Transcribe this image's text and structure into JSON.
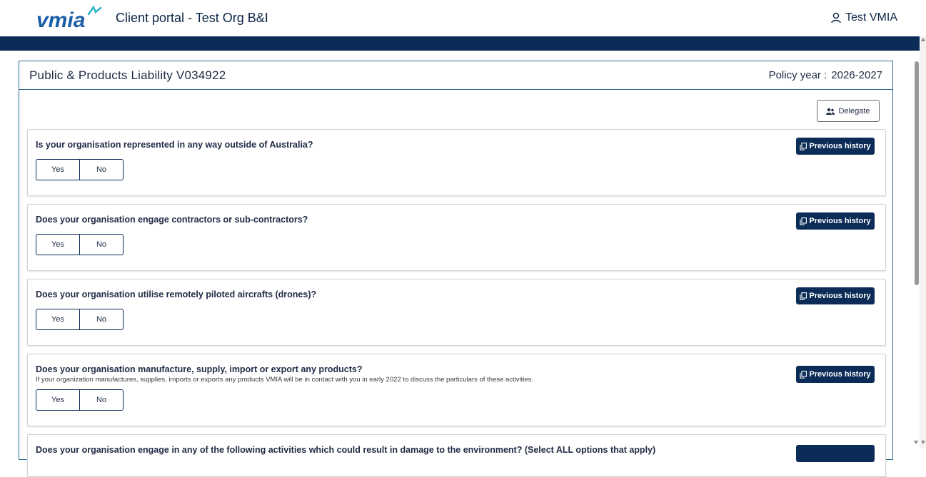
{
  "header": {
    "logo_text": "vmia",
    "portal_title": "Client portal - Test Org B&I",
    "user_name": "Test VMIA"
  },
  "panel": {
    "title": "Public & Products Liability V034922",
    "policy_year_label": "Policy year :",
    "policy_year_value": "2026-2027",
    "delegate_label": "Delegate"
  },
  "questions": [
    {
      "text": "Is your organisation represented in any way outside of Australia?",
      "yes": "Yes",
      "no": "No",
      "history": "Previous history"
    },
    {
      "text": "Does your organisation engage contractors or sub-contractors?",
      "yes": "Yes",
      "no": "No",
      "history": "Previous history"
    },
    {
      "text": "Does your organisation utilise remotely piloted aircrafts (drones)?",
      "yes": "Yes",
      "no": "No",
      "history": "Previous history"
    },
    {
      "text": "Does your organisation manufacture, supply, import or export any products?",
      "subtext": "If your organization manufactures, supplies, imports or exports any products VMIA will be in contact with you in early 2022 to discuss the particulars of these activities.",
      "yes": "Yes",
      "no": "No",
      "history": "Previous history"
    },
    {
      "text": "Does your organisation engage in any of the following activities which could result in damage to the environment? (Select ALL options that apply)"
    }
  ],
  "colors": {
    "navy": "#0a2c57",
    "border_blue": "#2f6a8f",
    "logo_blue": "#1a5ea8",
    "logo_teal": "#2bb3c9"
  }
}
